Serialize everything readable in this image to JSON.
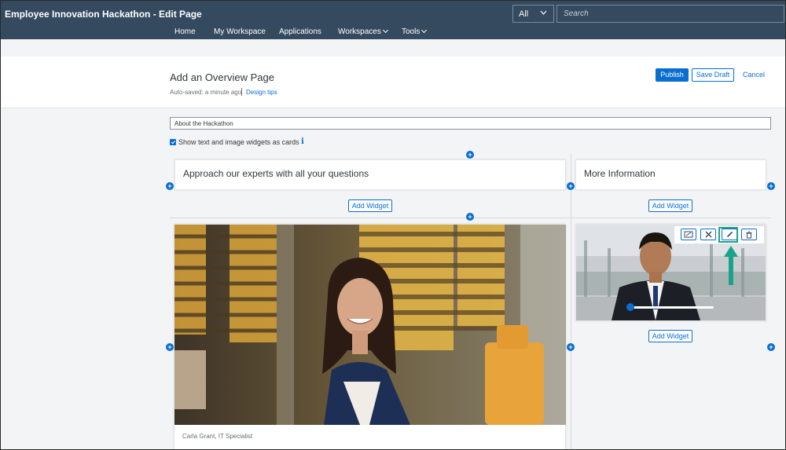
{
  "shell": {
    "title": "Employee Innovation Hackathon - Edit Page",
    "scope_value": "All",
    "search_placeholder": "Search",
    "nav": [
      {
        "label": "Home"
      },
      {
        "label": "My Workspace"
      },
      {
        "label": "Applications"
      },
      {
        "label": "Workspaces"
      },
      {
        "label": "Tools"
      }
    ]
  },
  "header": {
    "title": "Add an Overview Page",
    "autosave": "Auto-saved: a minute ago",
    "design_tips": "Design tips",
    "publish": "Publish",
    "save_draft": "Save Draft",
    "cancel": "Cancel"
  },
  "editor": {
    "page_name": "About the Hackathon",
    "show_cards_label": "Show text and image widgets as cards",
    "show_cards_checked": true,
    "info_icon": "i"
  },
  "layout": {
    "left_card_title": "Approach our experts with all your questions",
    "right_card_title": "More Information",
    "add_widget": "Add Widget",
    "left_image_caption": "Carla Grant, IT Specialist"
  },
  "image_toolbar": {
    "buttons": [
      {
        "icon": "resize-icon"
      },
      {
        "icon": "close-icon"
      },
      {
        "icon": "edit-pencil-icon"
      },
      {
        "icon": "trash-icon"
      }
    ],
    "highlight_color": "#1ba38a"
  },
  "colors": {
    "shell": "#354a5f",
    "accent": "#0a6ed1"
  }
}
